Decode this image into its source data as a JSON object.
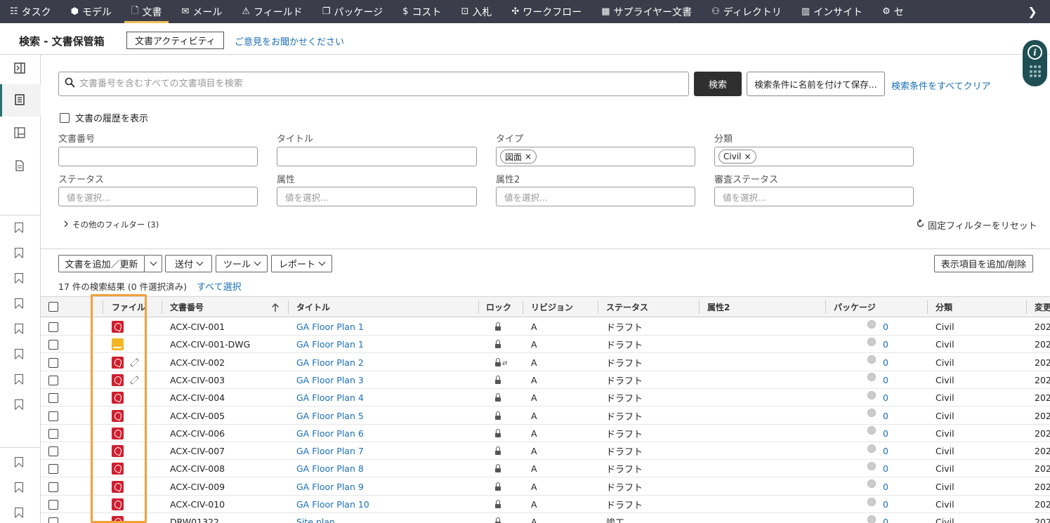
{
  "nav": {
    "items": [
      {
        "label": "タスク",
        "icon": "tasks-icon"
      },
      {
        "label": "モデル",
        "icon": "model-icon"
      },
      {
        "label": "文書",
        "icon": "document-icon",
        "active": true
      },
      {
        "label": "メール",
        "icon": "mail-icon"
      },
      {
        "label": "フィールド",
        "icon": "field-icon"
      },
      {
        "label": "パッケージ",
        "icon": "package-icon"
      },
      {
        "label": "コスト",
        "icon": "cost-icon"
      },
      {
        "label": "入札",
        "icon": "bid-icon"
      },
      {
        "label": "ワークフロー",
        "icon": "workflow-icon"
      },
      {
        "label": "サプライヤー文書",
        "icon": "supplier-doc-icon"
      },
      {
        "label": "ディレクトリ",
        "icon": "directory-icon"
      },
      {
        "label": "インサイト",
        "icon": "insight-icon"
      },
      {
        "label": "セ",
        "icon": "settings-icon"
      }
    ],
    "more_icon": "chevron-right-icon"
  },
  "header": {
    "title": "検索 - 文書保管箱",
    "activity_button": "文書アクティビティ",
    "feedback_link": "ご意見をお聞かせください"
  },
  "search": {
    "placeholder": "文書番号を含むすべての文書項目を検索",
    "value": "",
    "button": "検索",
    "save_button": "検索条件に名前を付けて保存...",
    "clear_link": "検索条件をすべてクリア"
  },
  "filters": {
    "history_checkbox": "文書の履歴を表示",
    "doc_number": {
      "label": "文書番号",
      "value": ""
    },
    "title": {
      "label": "タイトル",
      "value": ""
    },
    "type": {
      "label": "タイプ",
      "chip": "図面"
    },
    "discipline": {
      "label": "分類",
      "chip": "Civil"
    },
    "status": {
      "label": "ステータス",
      "placeholder": "値を選択..."
    },
    "attribute": {
      "label": "属性",
      "placeholder": "値を選択..."
    },
    "attribute2": {
      "label": "属性2",
      "placeholder": "値を選択..."
    },
    "review_status": {
      "label": "審査ステータス",
      "placeholder": "値を選択..."
    },
    "more_filters": "その他のフィルター (3)",
    "reset_fixed": "固定フィルターをリセット"
  },
  "toolbar": {
    "add_update": "文書を追加／更新",
    "send": "送付",
    "tools": "ツール",
    "report": "レポート",
    "columns": "表示項目を追加/削除"
  },
  "results": {
    "count_text": "17 件の検索結果 (0 件選択済み)",
    "select_all": "すべて選択"
  },
  "table": {
    "headers": {
      "file": "ファイル",
      "doc_number": "文書番号",
      "title": "タイトル",
      "lock": "ロック",
      "revision": "リビジョン",
      "status": "ステータス",
      "attribute2": "属性2",
      "package": "パッケージ",
      "discipline": "分類",
      "modified": "変更"
    },
    "rows": [
      {
        "file": "pdf",
        "edit": false,
        "doc": "ACX-CIV-001",
        "title": "GA Floor Plan 1",
        "lock": "unlocked",
        "rev": "A",
        "status": "ドラフト",
        "attr2": "",
        "pkg": "0",
        "disc": "Civil",
        "mod": "202"
      },
      {
        "file": "dwg",
        "edit": false,
        "doc": "ACX-CIV-001-DWG",
        "title": "GA Floor Plan 1",
        "lock": "unlocked",
        "rev": "A",
        "status": "ドラフト",
        "attr2": "",
        "pkg": "0",
        "disc": "Civil",
        "mod": "202"
      },
      {
        "file": "pdf",
        "edit": true,
        "doc": "ACX-CIV-002",
        "title": "GA Floor Plan 2",
        "lock": "locked",
        "rev": "A",
        "status": "ドラフト",
        "attr2": "",
        "pkg": "0",
        "disc": "Civil",
        "mod": "202"
      },
      {
        "file": "pdf",
        "edit": true,
        "doc": "ACX-CIV-003",
        "title": "GA Floor Plan 3",
        "lock": "unlocked",
        "rev": "A",
        "status": "ドラフト",
        "attr2": "",
        "pkg": "0",
        "disc": "Civil",
        "mod": "202"
      },
      {
        "file": "pdf",
        "edit": false,
        "doc": "ACX-CIV-004",
        "title": "GA Floor Plan 4",
        "lock": "unlocked",
        "rev": "A",
        "status": "ドラフト",
        "attr2": "",
        "pkg": "0",
        "disc": "Civil",
        "mod": "202"
      },
      {
        "file": "pdf",
        "edit": false,
        "doc": "ACX-CIV-005",
        "title": "GA Floor Plan 5",
        "lock": "unlocked",
        "rev": "A",
        "status": "ドラフト",
        "attr2": "",
        "pkg": "0",
        "disc": "Civil",
        "mod": "202"
      },
      {
        "file": "pdf",
        "edit": false,
        "doc": "ACX-CIV-006",
        "title": "GA Floor Plan 6",
        "lock": "unlocked",
        "rev": "A",
        "status": "ドラフト",
        "attr2": "",
        "pkg": "0",
        "disc": "Civil",
        "mod": "202"
      },
      {
        "file": "pdf",
        "edit": false,
        "doc": "ACX-CIV-007",
        "title": "GA Floor Plan 7",
        "lock": "unlocked",
        "rev": "A",
        "status": "ドラフト",
        "attr2": "",
        "pkg": "0",
        "disc": "Civil",
        "mod": "202"
      },
      {
        "file": "pdf",
        "edit": false,
        "doc": "ACX-CIV-008",
        "title": "GA Floor Plan 8",
        "lock": "unlocked",
        "rev": "A",
        "status": "ドラフト",
        "attr2": "",
        "pkg": "0",
        "disc": "Civil",
        "mod": "202"
      },
      {
        "file": "pdf",
        "edit": false,
        "doc": "ACX-CIV-009",
        "title": "GA Floor Plan 9",
        "lock": "unlocked",
        "rev": "A",
        "status": "ドラフト",
        "attr2": "",
        "pkg": "0",
        "disc": "Civil",
        "mod": "202"
      },
      {
        "file": "pdf",
        "edit": false,
        "doc": "ACX-CIV-010",
        "title": "GA Floor Plan 10",
        "lock": "unlocked",
        "rev": "A",
        "status": "ドラフト",
        "attr2": "",
        "pkg": "0",
        "disc": "Civil",
        "mod": "202"
      },
      {
        "file": "pdf",
        "edit": false,
        "doc": "DRW01322",
        "title": "Site plan",
        "lock": "unlocked",
        "rev": "A",
        "status": "竣工",
        "attr2": "",
        "pkg": "0",
        "disc": "Civil",
        "mod": "202"
      }
    ]
  },
  "colors": {
    "nav_bg": "#3b3d4a",
    "nav_active_underline": "#f0c05a",
    "link": "#1b6fb5",
    "pdf": "#d01f2f",
    "dwg": "#f4b624",
    "highlight": "#f0a13b",
    "info_widget": "#1f4f55"
  }
}
